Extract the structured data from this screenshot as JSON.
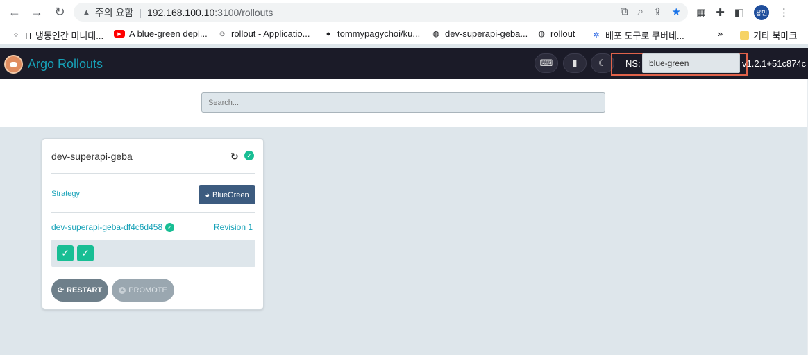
{
  "browser": {
    "security_label": "주의 요함",
    "url_host": "192.168.100.10",
    "url_path": ":3100/rollouts",
    "profile_initials": "용민"
  },
  "bookmarks": [
    {
      "label": "IT 냉동인간 미니대...",
      "icon": "apps-icon"
    },
    {
      "label": "A blue-green depl...",
      "icon": "youtube-icon"
    },
    {
      "label": "rollout - Applicatio...",
      "icon": "argo-icon"
    },
    {
      "label": "tommypagychoi/ku...",
      "icon": "github-icon"
    },
    {
      "label": "dev-superapi-geba...",
      "icon": "globe-icon"
    },
    {
      "label": "rollout",
      "icon": "globe-icon"
    },
    {
      "label": "배포 도구로 쿠버네...",
      "icon": "kubernetes-icon"
    },
    {
      "label": "기타 북마크",
      "icon": "folder-icon"
    }
  ],
  "header": {
    "title": "Argo Rollouts",
    "ns_label": "NS:",
    "ns_value": "blue-green",
    "version": "v1.2.1+51c874c"
  },
  "search": {
    "placeholder": "Search..."
  },
  "rollout": {
    "name": "dev-superapi-geba",
    "strategy_label": "Strategy",
    "strategy": "BlueGreen",
    "replicaset": "dev-superapi-geba-df4c6d458",
    "revision": "Revision 1",
    "pods": 2,
    "restart_label": "RESTART",
    "promote_label": "PROMOTE"
  },
  "colors": {
    "accent": "#17a2b8",
    "healthy": "#18be94",
    "header_bg": "#1b1b28",
    "ns_highlight": "#e0624a"
  }
}
